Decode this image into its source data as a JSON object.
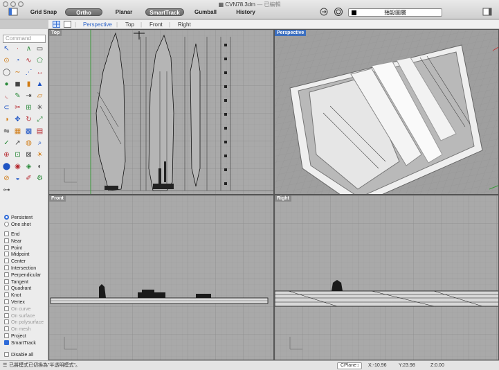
{
  "window": {
    "title": "CVN78.3dm",
    "subtitle": "— 已編輯"
  },
  "toolbar": {
    "grid_snap": "Grid Snap",
    "ortho": "Ortho",
    "planar": "Planar",
    "smarttrack": "SmartTrack",
    "gumball": "Gumball",
    "history": "History",
    "layer": "預設圖層",
    "icons": [
      "sidebar-toggle-icon",
      "record-history-icon",
      "target-icon",
      "panel-toggle-icon"
    ]
  },
  "tabs": [
    "Perspective",
    "Top",
    "Front",
    "Right"
  ],
  "command_placeholder": "Command",
  "tool_icons": [
    "select-arrow-icon",
    "point-icon",
    "polyline-icon",
    "rectangle-icon",
    "circle-icon",
    "arc-icon",
    "curve-icon",
    "polygon-icon",
    "ellipse-icon",
    "freeform-icon",
    "curve-edit-icon",
    "dimension-icon",
    "sphere-icon",
    "box-icon",
    "cylinder-icon",
    "cone-icon",
    "fillet-icon",
    "paint-icon",
    "extend-icon",
    "plane-icon",
    "offset-icon",
    "split-icon",
    "join-icon",
    "explode-icon",
    "boolean-icon",
    "move-icon",
    "rotate-icon",
    "scale-icon",
    "mirror-icon",
    "array-icon",
    "grid-icon",
    "layer-icon",
    "check-icon",
    "cursor-icon",
    "render-icon",
    "zoom-icon",
    "zoom-in-icon",
    "zoom-window-icon",
    "zoom-extents-icon",
    "light-icon",
    "camera-icon",
    "eye-icon",
    "lock-icon",
    "color-icon",
    "globe-icon",
    "sphere-shade-icon",
    "pipette-icon",
    "gear-icon",
    "align-icon"
  ],
  "osnap": {
    "persistent": "Persistent",
    "one_shot": "One shot",
    "items": [
      {
        "label": "End",
        "checked": false,
        "dim": false
      },
      {
        "label": "Near",
        "checked": false,
        "dim": false
      },
      {
        "label": "Point",
        "checked": false,
        "dim": false
      },
      {
        "label": "Midpoint",
        "checked": false,
        "dim": false
      },
      {
        "label": "Center",
        "checked": false,
        "dim": false
      },
      {
        "label": "Intersection",
        "checked": false,
        "dim": false
      },
      {
        "label": "Perpendicular",
        "checked": false,
        "dim": false
      },
      {
        "label": "Tangent",
        "checked": false,
        "dim": false
      },
      {
        "label": "Quadrant",
        "checked": false,
        "dim": false
      },
      {
        "label": "Knot",
        "checked": false,
        "dim": false
      },
      {
        "label": "Vertex",
        "checked": false,
        "dim": false
      },
      {
        "label": "On curve",
        "checked": false,
        "dim": true
      },
      {
        "label": "On surface",
        "checked": false,
        "dim": true
      },
      {
        "label": "On polysurface",
        "checked": false,
        "dim": true
      },
      {
        "label": "On mesh",
        "checked": false,
        "dim": true
      },
      {
        "label": "Project",
        "checked": false,
        "dim": false
      },
      {
        "label": "SmartTrack",
        "checked": true,
        "dim": false
      }
    ],
    "disable_all": "Disable all"
  },
  "viewports": {
    "top": "Top",
    "perspective": "Perspective",
    "front": "Front",
    "right": "Right"
  },
  "status": {
    "message": "已將模式已切換為\"半透明模式\"。",
    "cplane": "CPlane",
    "x": "X:-10.96",
    "y": "Y:23.98",
    "z": "Z:0.00"
  },
  "colors": {
    "active_blue": "#3c6fbf",
    "viewport_bg": "#a8a8a8",
    "checkbox_blue": "#2f6bd8"
  }
}
